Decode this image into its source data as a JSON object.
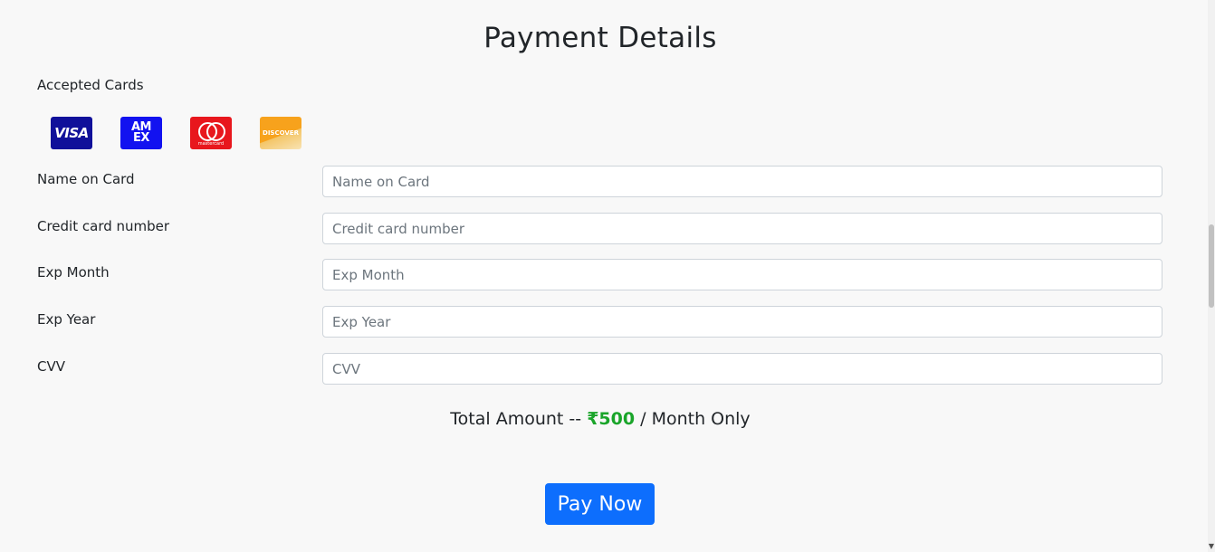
{
  "page": {
    "title": "Payment Details"
  },
  "accepted_cards": {
    "label": "Accepted Cards",
    "cards": [
      {
        "name": "visa",
        "text": "VISA"
      },
      {
        "name": "amex",
        "text": "AM EX"
      },
      {
        "name": "mastercard",
        "text": "mastercard"
      },
      {
        "name": "discover",
        "text": "DISCOVER"
      }
    ]
  },
  "form": {
    "name": {
      "label": "Name on Card",
      "placeholder": "Name on Card",
      "value": ""
    },
    "card_number": {
      "label": "Credit card number",
      "placeholder": "Credit card number",
      "value": ""
    },
    "exp_month": {
      "label": "Exp Month",
      "placeholder": "Exp Month",
      "value": ""
    },
    "exp_year": {
      "label": "Exp Year",
      "placeholder": "Exp Year",
      "value": ""
    },
    "cvv": {
      "label": "CVV",
      "placeholder": "CVV",
      "value": ""
    }
  },
  "total": {
    "prefix": "Total Amount --",
    "amount": "₹500",
    "suffix": "/ Month Only"
  },
  "pay_button": {
    "label": "Pay Now"
  },
  "colors": {
    "accent": "#0d6efd",
    "amount": "#1aa52a",
    "background": "#f8f8f8"
  },
  "icons": {
    "scroll_down": "chevron-down-icon"
  }
}
